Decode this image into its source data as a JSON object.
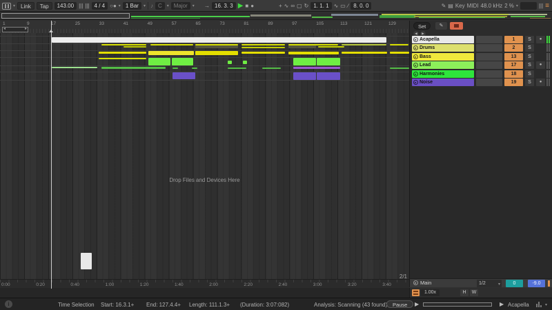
{
  "topbar": {
    "link": "Link",
    "tap": "Tap",
    "tempo": "143.00",
    "nudge_down": "|||",
    "nudge_up": "|||",
    "time_sig": "4 / 4",
    "quantize_menu": "1 Bar",
    "key_root": "C",
    "key_scale": "Major",
    "position": "16. 3. 3",
    "loop_start": "1. 1. 1",
    "loop_length": "8. 0. 0",
    "key_label": "Key",
    "midi_label": "MIDI",
    "sample_rate": "48.0 kHz",
    "cpu": "2 %"
  },
  "icons": {
    "caret": "▾",
    "play": "▶",
    "stop": "■",
    "record": "●",
    "metronome": "○●",
    "scale": "♪",
    "follow": "→",
    "capture": "+",
    "automation": "∿",
    "relink": "∞",
    "punch": "▢",
    "loop": "↻",
    "fade": "∿",
    "loop_brace": "▭",
    "ramp": "∕",
    "pencil": "✎",
    "keyboard": "▤",
    "cpu_bars": "|||",
    "menu": "≡",
    "info": "i",
    "track_play": "▸",
    "arm": "●",
    "prev": "◀",
    "next": "▶"
  },
  "ruler": {
    "set_label": "Set",
    "bars": [
      "1",
      "9",
      "17",
      "25",
      "33",
      "41",
      "49",
      "57",
      "65",
      "73",
      "81",
      "89",
      "97",
      "105",
      "113",
      "121",
      "129"
    ]
  },
  "overview": {
    "segments": [
      [
        190,
        5,
        172,
        2,
        "#49cf49"
      ],
      [
        190,
        8,
        100,
        1,
        "#2f8f2f"
      ],
      [
        363,
        3,
        88,
        3,
        "#86867a"
      ],
      [
        452,
        6,
        30,
        2,
        "#54bd46"
      ],
      [
        480,
        2,
        68,
        3,
        "#7d8795"
      ],
      [
        550,
        4,
        52,
        4,
        "#3f9f3f"
      ],
      [
        553,
        2,
        185,
        2,
        "#b7c546"
      ],
      [
        600,
        5,
        135,
        2,
        "#99a133"
      ],
      [
        607,
        7,
        125,
        1,
        "#49cf49"
      ],
      [
        737,
        2,
        56,
        2,
        "#aeb68e"
      ],
      [
        740,
        5,
        50,
        2,
        "#54bd46"
      ],
      [
        768,
        8,
        30,
        1,
        "#8a6a3a"
      ]
    ]
  },
  "labels": {
    "solo": "S"
  },
  "tracks": [
    {
      "name": "Acapella",
      "color": "#e8e8e8",
      "num": "1",
      "armed": true,
      "meter_active": true
    },
    {
      "name": "Drums",
      "color": "#dde06e",
      "num": "2",
      "armed": false,
      "meter_active": false
    },
    {
      "name": "Bass",
      "color": "#f0e93c",
      "num": "13",
      "armed": false,
      "meter_active": false
    },
    {
      "name": "Lead",
      "color": "#8cf05a",
      "num": "17",
      "armed": true,
      "meter_active": false
    },
    {
      "name": "Harmonies",
      "color": "#2ee53c",
      "num": "18",
      "armed": false,
      "meter_active": false
    },
    {
      "name": "Noise",
      "color": "#6a4fc4",
      "num": "19",
      "armed": true,
      "meter_active": false
    }
  ],
  "arrange": {
    "drop_text": "Drop Files and Devices Here",
    "grid_label": "2/1",
    "lane_lines": [
      4,
      15,
      25,
      35,
      47,
      56,
      68
    ]
  },
  "clips": [
    [
      75,
      6,
      485,
      8,
      "#ededed"
    ],
    [
      147,
      16,
      65,
      2,
      "#d8e000"
    ],
    [
      179,
      19,
      33,
      2,
      "#c0cc00"
    ],
    [
      218,
      16,
      62,
      2,
      "#d8e000"
    ],
    [
      283,
      16,
      62,
      6,
      "#55553f"
    ],
    [
      283,
      16,
      62,
      2,
      "#d8e000"
    ],
    [
      350,
      16,
      63,
      2,
      "#d8e000"
    ],
    [
      350,
      20,
      63,
      2,
      "#c0cc00"
    ],
    [
      418,
      16,
      40,
      6,
      "#55553f"
    ],
    [
      418,
      16,
      72,
      2,
      "#d8e000"
    ],
    [
      461,
      19,
      38,
      2,
      "#c8d400"
    ],
    [
      495,
      16,
      65,
      2,
      "#b8c83a"
    ],
    [
      565,
      16,
      27,
      2,
      "#d8e000"
    ],
    [
      143,
      27,
      69,
      3,
      "#e4de00"
    ],
    [
      215,
      26,
      66,
      6,
      "#eee42c"
    ],
    [
      283,
      26,
      62,
      6,
      "#e4de00"
    ],
    [
      350,
      27,
      63,
      3,
      "#e4de00"
    ],
    [
      418,
      27,
      73,
      4,
      "#e4de00"
    ],
    [
      495,
      27,
      66,
      3,
      "#e4de00"
    ],
    [
      565,
      27,
      28,
      3,
      "#e4de00"
    ],
    [
      143,
      36,
      69,
      2,
      "#d8e000"
    ],
    [
      215,
      36,
      32,
      11,
      "#6fee43"
    ],
    [
      249,
      36,
      31,
      11,
      "#6fee43"
    ],
    [
      330,
      40,
      6,
      5,
      "#6fee43"
    ],
    [
      352,
      40,
      6,
      5,
      "#6fee43"
    ],
    [
      425,
      36,
      33,
      11,
      "#6fee43"
    ],
    [
      459,
      36,
      34,
      11,
      "#6fee43"
    ],
    [
      75,
      49,
      66,
      2,
      "#9ce08e"
    ],
    [
      147,
      49,
      93,
      3,
      "#54bd46"
    ],
    [
      250,
      50,
      8,
      2,
      "#54bd46"
    ],
    [
      278,
      50,
      8,
      2,
      "#54bd46"
    ],
    [
      330,
      50,
      27,
      2,
      "#54bd46"
    ],
    [
      380,
      50,
      27,
      2,
      "#54bd46"
    ],
    [
      425,
      49,
      68,
      3,
      "#9b59d0"
    ],
    [
      565,
      50,
      28,
      2,
      "#54bd46"
    ],
    [
      250,
      57,
      33,
      10,
      "#6a50c8"
    ],
    [
      425,
      57,
      33,
      11,
      "#6a50c8"
    ],
    [
      459,
      57,
      34,
      11,
      "#6a50c8"
    ]
  ],
  "time_ruler": {
    "labels": [
      "0:00",
      "0:20",
      "0:40",
      "1:00",
      "1:20",
      "1:40",
      "2:00",
      "2:20",
      "2:40",
      "3:00",
      "3:20",
      "3:40"
    ]
  },
  "main_track": {
    "name": "Main",
    "grid": "1/2",
    "pan": "0",
    "volume": "-9.0",
    "speed": "1.00x",
    "hide": "H",
    "width": "W"
  },
  "statusbar": {
    "mode": "Time Selection",
    "start": "Start: 16.3.1+",
    "end": "End: 127.4.4+",
    "length": "Length: 111.1.3+",
    "duration": "(Duration: 3:07:082)",
    "analysis": "Analysis: Scanning (43 found)",
    "pause": "Pause",
    "selected_track": "Acapella"
  },
  "colors": {
    "accent_orange": "#e0924e",
    "play_green": "#3ddc3d",
    "back_to_arrangement": "#d9684a",
    "pan_teal": "#1d9e9e",
    "volume_blue": "#5572d9",
    "meter_green": "#3fd63f"
  }
}
